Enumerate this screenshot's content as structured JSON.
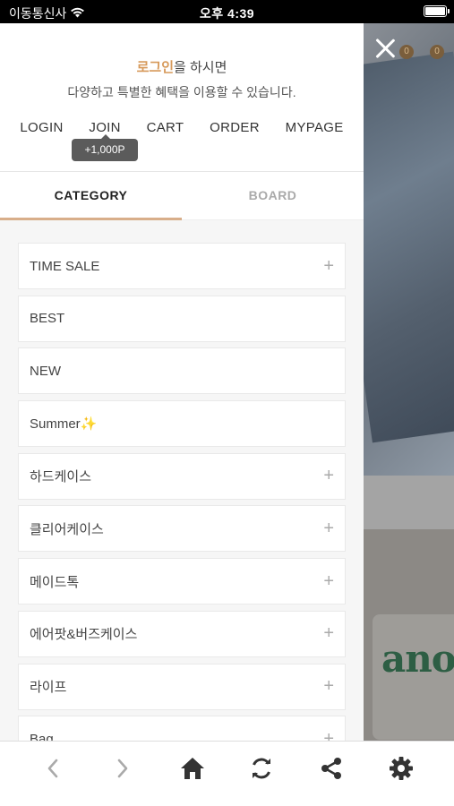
{
  "status_bar": {
    "carrier": "이동통신사",
    "time": "오후 4:39"
  },
  "login_message": {
    "highlight": "로그인",
    "line1_rest": "을 하시면",
    "line2": "다양하고 특별한 혜택을 이용할 수 있습니다."
  },
  "top_links": [
    {
      "label": "LOGIN"
    },
    {
      "label": "JOIN"
    },
    {
      "label": "CART"
    },
    {
      "label": "ORDER"
    },
    {
      "label": "MYPAGE"
    }
  ],
  "join_points": "+1,000P",
  "tabs": [
    {
      "label": "CATEGORY",
      "active": true
    },
    {
      "label": "BOARD",
      "active": false
    }
  ],
  "categories": [
    {
      "label": "TIME SALE",
      "expandable": true
    },
    {
      "label": "BEST",
      "expandable": false
    },
    {
      "label": "NEW",
      "expandable": false
    },
    {
      "label": "Summer✨",
      "expandable": false
    },
    {
      "label": "하드케이스",
      "expandable": true
    },
    {
      "label": "클리어케이스",
      "expandable": true
    },
    {
      "label": "메이드톡",
      "expandable": true
    },
    {
      "label": "에어팟&버즈케이스",
      "expandable": true
    },
    {
      "label": "라이프",
      "expandable": true
    },
    {
      "label": "Bag",
      "expandable": true
    }
  ],
  "background": {
    "case_text": "anoth",
    "badges": [
      "0",
      "0"
    ]
  },
  "toolbar": [
    {
      "icon": "back-chevron-icon"
    },
    {
      "icon": "forward-chevron-icon"
    },
    {
      "icon": "home-icon"
    },
    {
      "icon": "refresh-icon"
    },
    {
      "icon": "share-icon"
    },
    {
      "icon": "gear-icon"
    }
  ],
  "colors": {
    "accent": "#d79a5b",
    "tab_underline": "#d8ae8a",
    "tooltip_bg": "#5b5b5b"
  }
}
